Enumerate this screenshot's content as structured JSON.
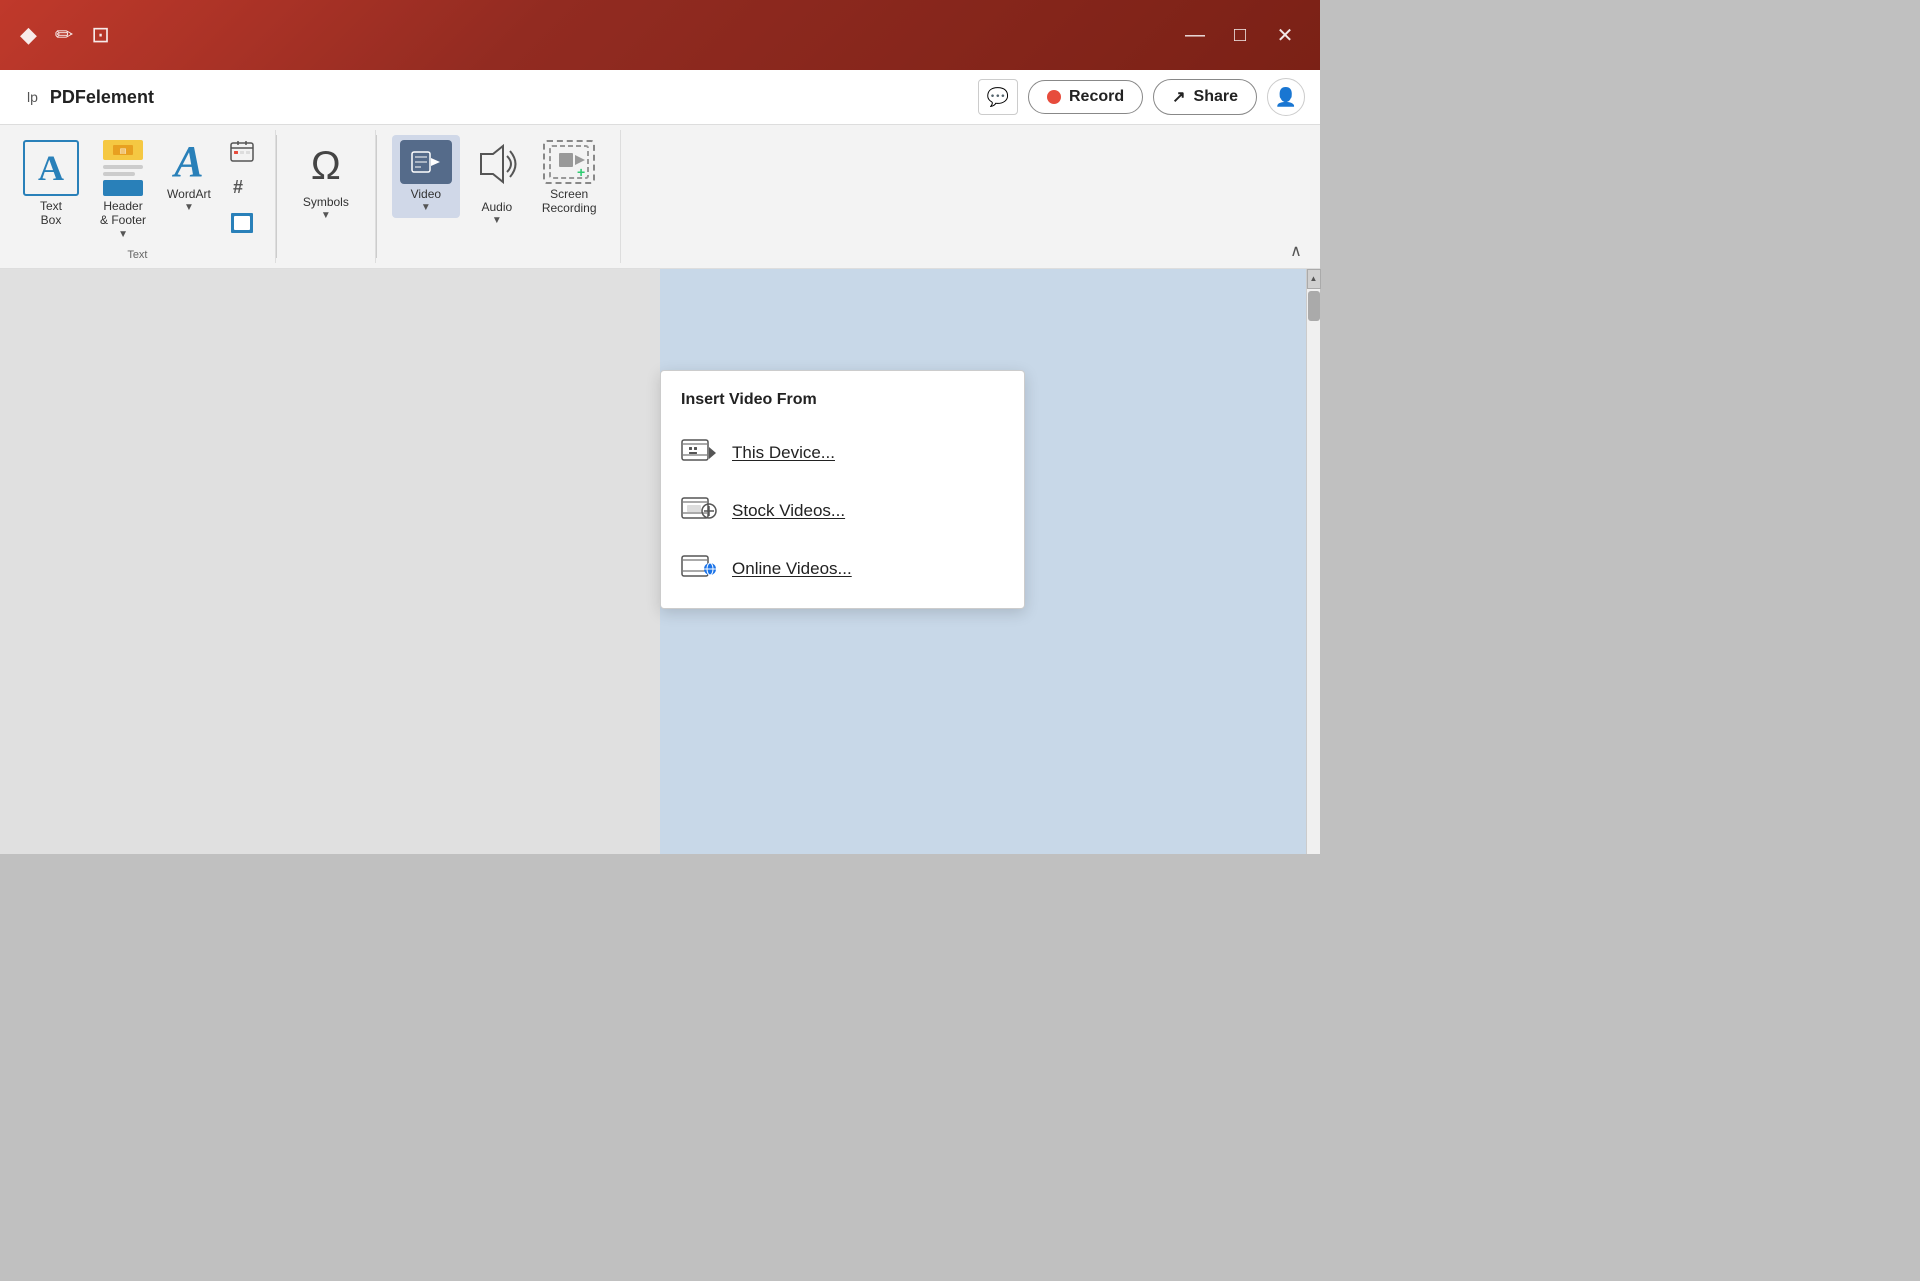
{
  "titlebar": {
    "icons": {
      "diamond": "◆",
      "pen": "✏",
      "expand": "⊡"
    },
    "controls": {
      "minimize": "—",
      "maximize": "□",
      "close": "✕"
    }
  },
  "menubar": {
    "items": [
      "lp"
    ]
  },
  "ribbon_header": {
    "app_name": "PDFelement",
    "buttons": {
      "comment_label": "💬",
      "record_label": "Record",
      "share_label": "Share",
      "profile_label": "👤"
    }
  },
  "ribbon": {
    "groups": [
      {
        "id": "text",
        "label": "Text",
        "items": [
          {
            "id": "text-box",
            "label": "Text\nBox"
          },
          {
            "id": "header-footer",
            "label": "Header\n& Footer"
          },
          {
            "id": "wordart",
            "label": "WordArt"
          },
          {
            "id": "small-icons",
            "items": [
              {
                "id": "calendar",
                "icon": "📅"
              },
              {
                "id": "hashtag",
                "icon": "#"
              },
              {
                "id": "frame",
                "icon": "🔲"
              }
            ]
          }
        ]
      },
      {
        "id": "symbols-group",
        "items": [
          {
            "id": "symbols",
            "label": "Symbols"
          }
        ]
      },
      {
        "id": "media",
        "items": [
          {
            "id": "video",
            "label": "Video",
            "active": true
          },
          {
            "id": "audio",
            "label": "Audio"
          },
          {
            "id": "screen-recording",
            "label": "Screen\nRecording"
          }
        ]
      }
    ]
  },
  "dropdown": {
    "title": "Insert Video From",
    "items": [
      {
        "id": "this-device",
        "label": "This Device...",
        "underline_char": "T"
      },
      {
        "id": "stock-videos",
        "label": "Stock Videos...",
        "underline_char": "S"
      },
      {
        "id": "online-videos",
        "label": "Online Videos...",
        "underline_char": "O"
      }
    ]
  }
}
